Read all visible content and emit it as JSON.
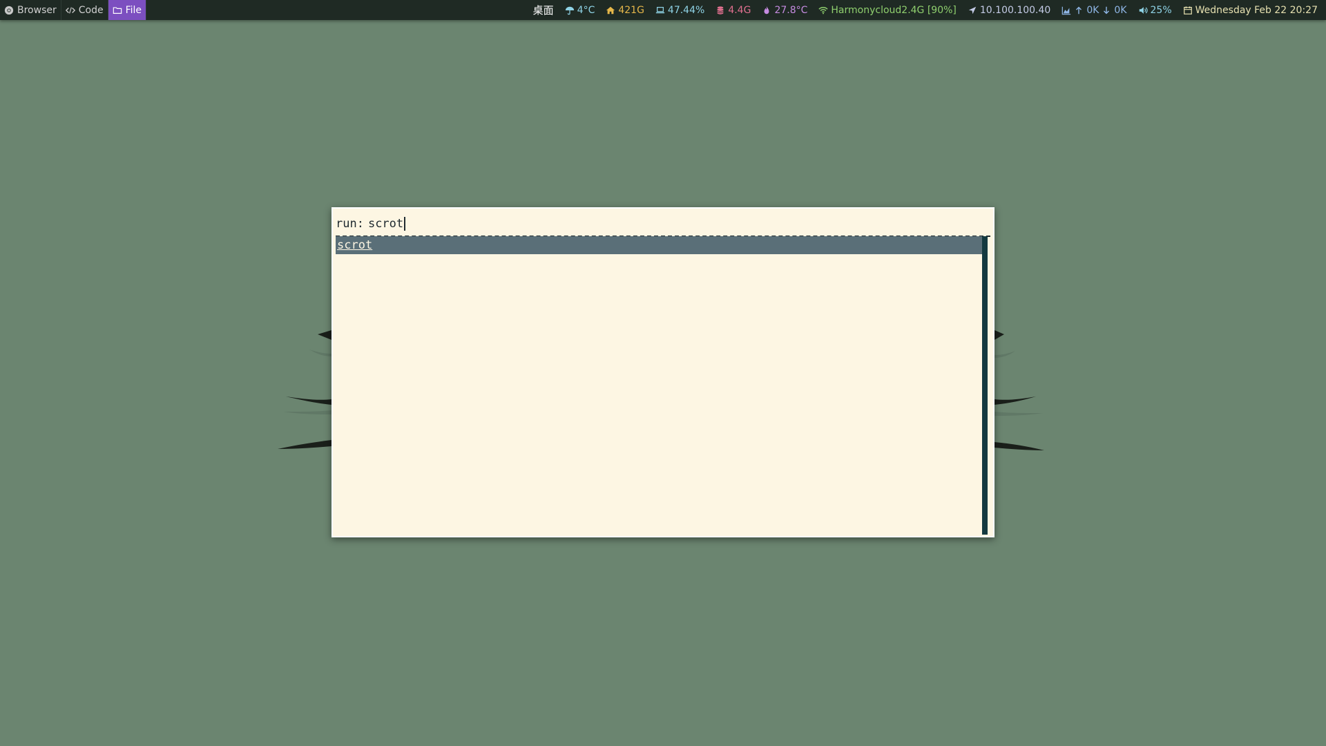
{
  "workspaces": [
    {
      "label": "Browser",
      "icon": "chrome-icon",
      "active": false
    },
    {
      "label": "Code",
      "icon": "code-icon",
      "active": false
    },
    {
      "label": "File",
      "icon": "folder-icon",
      "active": true
    }
  ],
  "status": {
    "workspace_name": "桌面",
    "weather": "4°C",
    "home_disk": "421G",
    "cpu": "47.44%",
    "memory": "4.4G",
    "temperature": "27.8°C",
    "wifi": "Harmonycloud2.4G [90%]",
    "ip": "10.100.100.40",
    "net_up": "0K",
    "net_down": "0K",
    "volume": "25%",
    "datetime": "Wednesday Feb 22 20:27"
  },
  "launcher": {
    "prompt": "run:",
    "input": "scrot",
    "entries": [
      "scrot"
    ],
    "selected_index": 0
  },
  "colors": {
    "background": "#6b8570",
    "bar": "#1f2a24",
    "active_workspace": "#7c4fc0",
    "launcher_bg": "#fdf6e3",
    "selection_bg": "#5a6f78",
    "scrollbar": "#143a40"
  }
}
